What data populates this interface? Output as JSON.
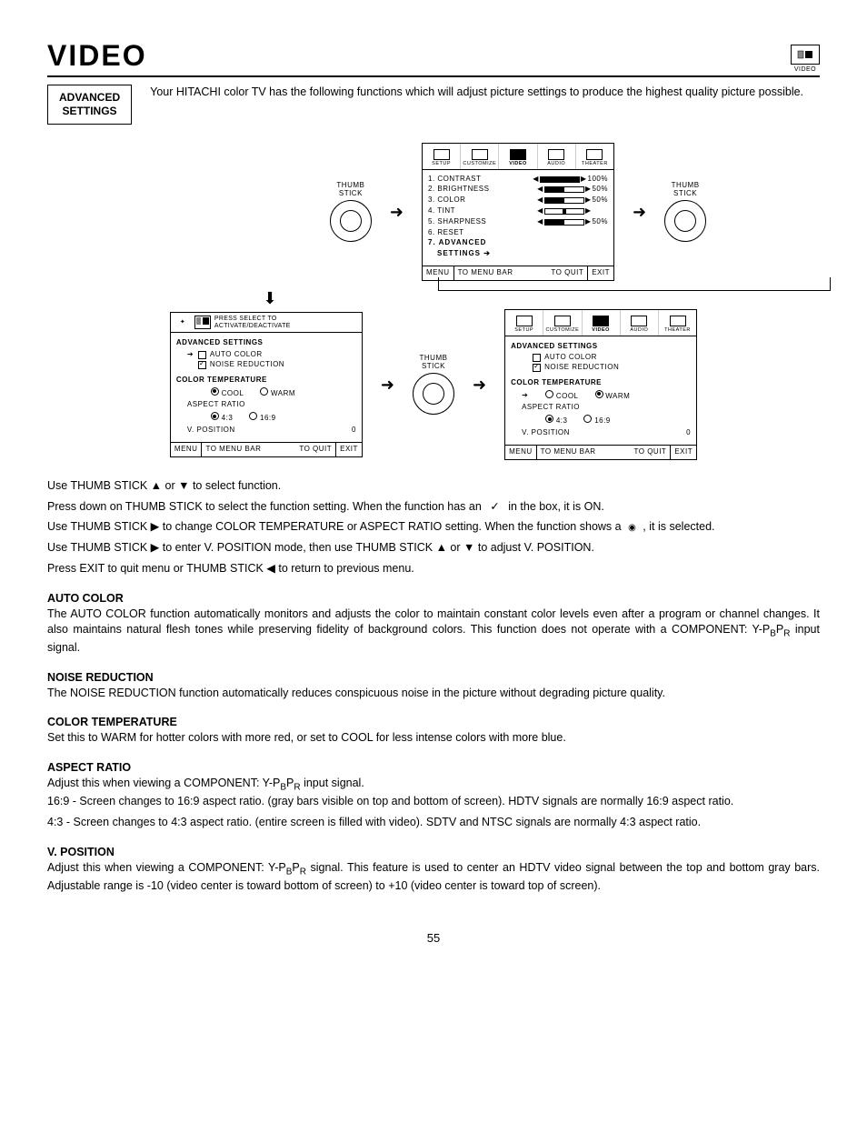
{
  "page_title": "VIDEO",
  "top_icon_label": "VIDEO",
  "section_label_l1": "ADVANCED",
  "section_label_l2": "SETTINGS",
  "intro": "Your HITACHI color TV has the following functions which will adjust picture settings to produce the highest quality picture possible.",
  "tabs": {
    "setup": "SETUP",
    "customize": "CUSTOMIZE",
    "video": "VIDEO",
    "audio": "AUDIO",
    "theater": "THEATER"
  },
  "thumb_label": "THUMB\nSTICK",
  "video_menu": {
    "r1": "1. CONTRAST",
    "v1": "100%",
    "r2": "2. BRIGHTNESS",
    "v2": "50%",
    "r3": "3. COLOR",
    "v3": "50%",
    "r4": "4. TINT",
    "r5": "5. SHARPNESS",
    "v5": "50%",
    "r6": "6. RESET",
    "r7a": "7. ADVANCED",
    "r7b": "SETTINGS"
  },
  "footer": {
    "menu": "MENU",
    "bar": "TO MENU BAR",
    "quit": "TO QUIT",
    "exit": "EXIT"
  },
  "press_select": "PRESS SELECT TO\nACTIVATE/DEACTIVATE",
  "adv": {
    "hdr": "ADVANCED SETTINGS",
    "auto": "AUTO COLOR",
    "noise": "NOISE REDUCTION",
    "ct_hdr": "COLOR TEMPERATURE",
    "cool": "COOL",
    "warm": "WARM",
    "ar_hdr": "ASPECT RATIO",
    "a43": "4:3",
    "a169": "16:9",
    "vpos": "V. POSITION",
    "vpos_v": "0"
  },
  "instr1": "Use THUMB STICK ▲ or ▼ to select function.",
  "instr2a": "Press down on THUMB STICK to select the function setting. When the function has an ",
  "instr2b": " in the box, it is ON.",
  "instr3a": "Use THUMB STICK ▶ to change COLOR TEMPERATURE or ASPECT RATIO setting.  When the function shows a ",
  "instr3b": " , it is selected.",
  "instr4": "Use THUMB STICK ▶ to enter V. POSITION mode, then use THUMB STICK ▲ or ▼ to adjust V. POSITION.",
  "instr5": "Press EXIT to quit menu or THUMB STICK ◀ to return to previous menu.",
  "s_auto_h": "AUTO COLOR",
  "s_auto_t1": "The AUTO COLOR function automatically monitors and adjusts the color to maintain constant color levels even after a program or channel changes. It also maintains natural flesh tones while preserving fidelity of background colors.  This function does not operate with a COMPONENT: Y-P",
  "s_auto_t2": " input signal.",
  "s_noise_h": "NOISE REDUCTION",
  "s_noise_t": "The NOISE REDUCTION function automatically reduces conspicuous noise in the picture without degrading picture quality.",
  "s_ct_h": "COLOR TEMPERATURE",
  "s_ct_t": "Set this to WARM for hotter colors with more red, or set to COOL for less intense colors with more blue.",
  "s_ar_h": "ASPECT RATIO",
  "s_ar_t1": "Adjust this when viewing a COMPONENT: Y-P",
  "s_ar_t2": " input signal.",
  "s_ar_t3": "16:9 - Screen changes to 16:9 aspect ratio. (gray bars visible on top and bottom of screen).  HDTV signals are normally 16:9 aspect ratio.",
  "s_ar_t4": "4:3 - Screen changes to 4:3 aspect ratio. (entire screen is filled  with video).  SDTV and NTSC signals are normally 4:3 aspect ratio.",
  "s_vp_h": "V. POSITION",
  "s_vp_t1": "Adjust this when viewing a COMPONENT: Y-P",
  "s_vp_t2": " signal.  This feature is used to center an HDTV video signal between the top and bottom gray bars.  Adjustable range is -10 (video center is toward bottom of screen) to +10 (video center is toward top of screen).",
  "pagenum": "55",
  "sub_b": "B",
  "sub_r": "R",
  "p_letter": "P",
  "check": "✓",
  "dot": "◉"
}
